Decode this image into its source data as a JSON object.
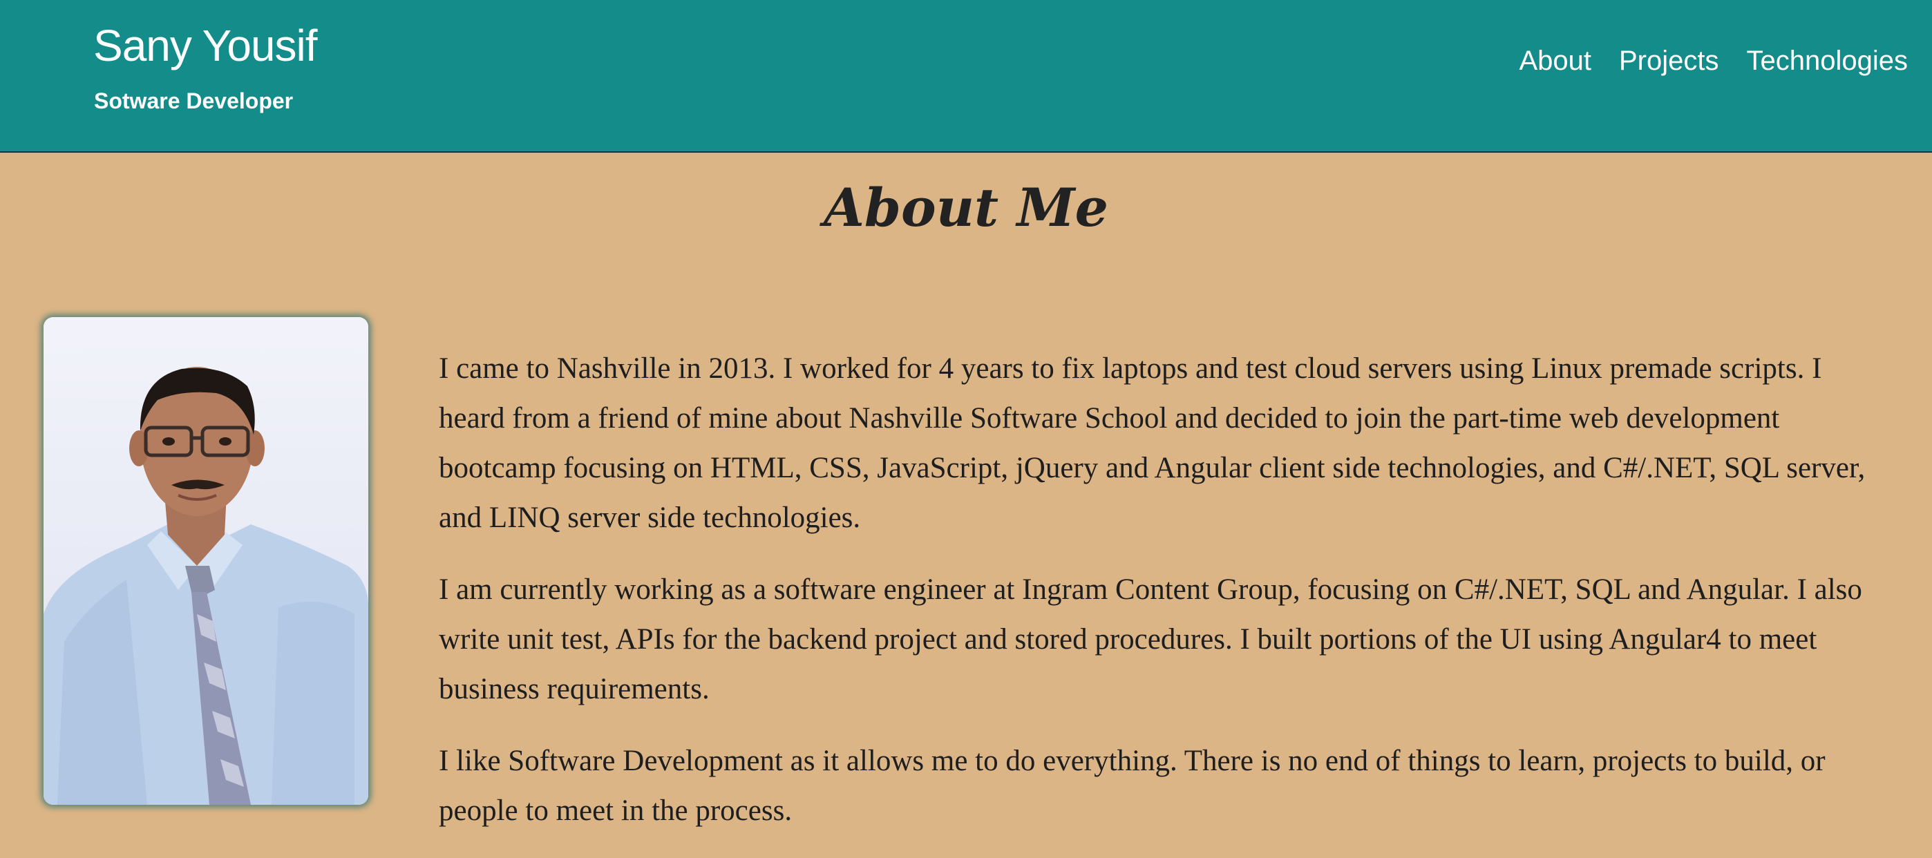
{
  "header": {
    "name": "Sany Yousif",
    "subtitle": "Sotware Developer",
    "nav": [
      {
        "label": "About"
      },
      {
        "label": "Projects"
      },
      {
        "label": "Technologies"
      }
    ]
  },
  "main": {
    "title": "About Me",
    "paragraphs": [
      "I came to Nashville in 2013. I worked for 4 years to fix laptops and test cloud servers using Linux premade scripts. I heard from a friend of mine about Nashville Software School and decided to join the part-time web development bootcamp focusing on HTML, CSS, JavaScript, jQuery and Angular client side technologies, and C#/.NET, SQL server, and LINQ server side technologies.",
      "I am currently working as a software engineer at Ingram Content Group, focusing on C#/.NET, SQL and Angular. I also write unit test, APIs for the backend project and stored procedures. I built portions of the UI using Angular4 to meet business requirements.",
      "I like Software Development as it allows me to do everything. There is no end of things to learn, projects to build, or people to meet in the process."
    ]
  },
  "colors": {
    "header_bg": "#138c8a",
    "page_bg": "#dcb587",
    "text": "#1e1e1e"
  }
}
